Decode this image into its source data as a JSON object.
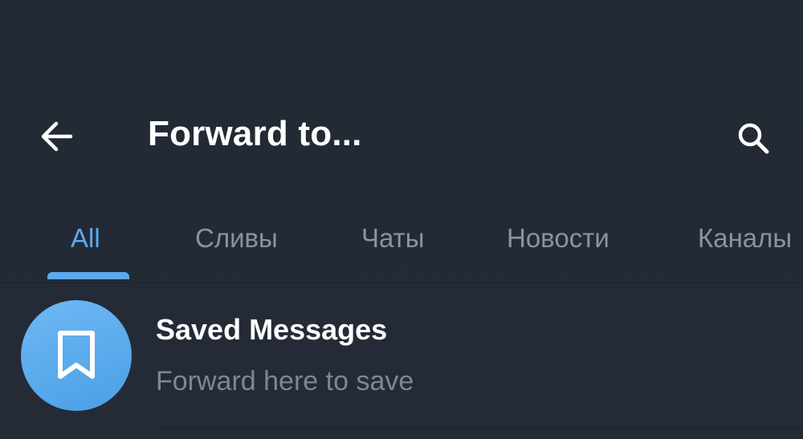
{
  "header": {
    "title": "Forward to...",
    "back_icon": "arrow-left-icon",
    "search_icon": "search-icon"
  },
  "tabs": [
    {
      "label": "All",
      "active": true
    },
    {
      "label": "Сливы",
      "active": false
    },
    {
      "label": "Чаты",
      "active": false
    },
    {
      "label": "Новости",
      "active": false
    },
    {
      "label": "Каналы",
      "active": false
    }
  ],
  "chats": [
    {
      "name": "Saved Messages",
      "subtitle": "Forward here to save",
      "avatar_icon": "bookmark-icon"
    }
  ],
  "colors": {
    "background": "#232a35",
    "accent": "#5aa9ee",
    "text_primary": "#ffffff",
    "text_secondary": "#7d8793"
  }
}
